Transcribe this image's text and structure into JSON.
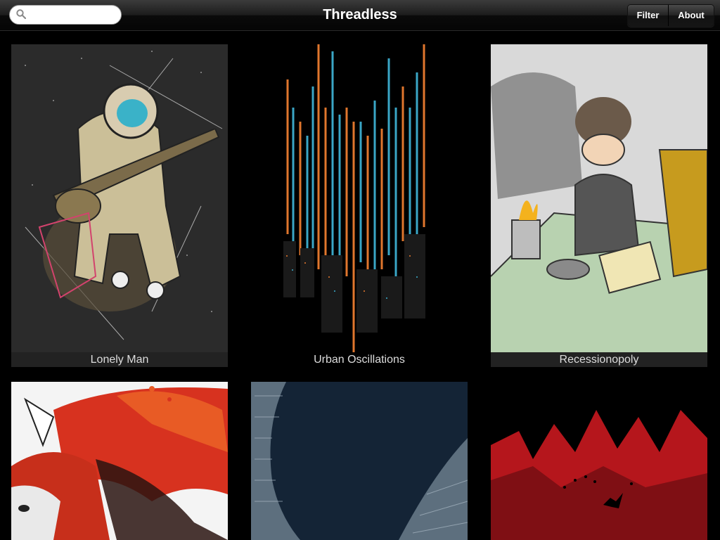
{
  "app": {
    "title": "Threadless"
  },
  "search": {
    "placeholder": "",
    "value": ""
  },
  "nav": {
    "filter_label": "Filter",
    "about_label": "About"
  },
  "designs": [
    {
      "title": "Lonely Man"
    },
    {
      "title": "Urban Oscillations"
    },
    {
      "title": "Recessionopoly"
    },
    {
      "title": ""
    },
    {
      "title": ""
    },
    {
      "title": ""
    }
  ]
}
